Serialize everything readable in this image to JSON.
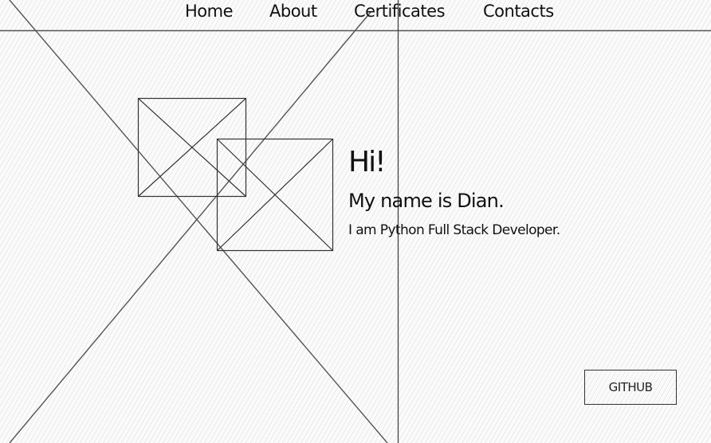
{
  "nav": {
    "items": [
      {
        "label": "Home"
      },
      {
        "label": "About"
      },
      {
        "label": "Certificates"
      },
      {
        "label": "Contacts"
      }
    ]
  },
  "hero": {
    "greeting": "Hi!",
    "name_line": "My name is Dian.",
    "role_line": "I am Python Full Stack Developer."
  },
  "images": {
    "placeholders": [
      {
        "icon": "image-placeholder-icon"
      },
      {
        "icon": "image-placeholder-icon"
      }
    ],
    "background_placeholder": {
      "icon": "image-placeholder-icon"
    }
  },
  "actions": {
    "github_label": "GITHUB"
  },
  "colors": {
    "ink": "#1a1a1a",
    "paper": "#fbfbfb",
    "hatch": "#e0e0e0"
  }
}
